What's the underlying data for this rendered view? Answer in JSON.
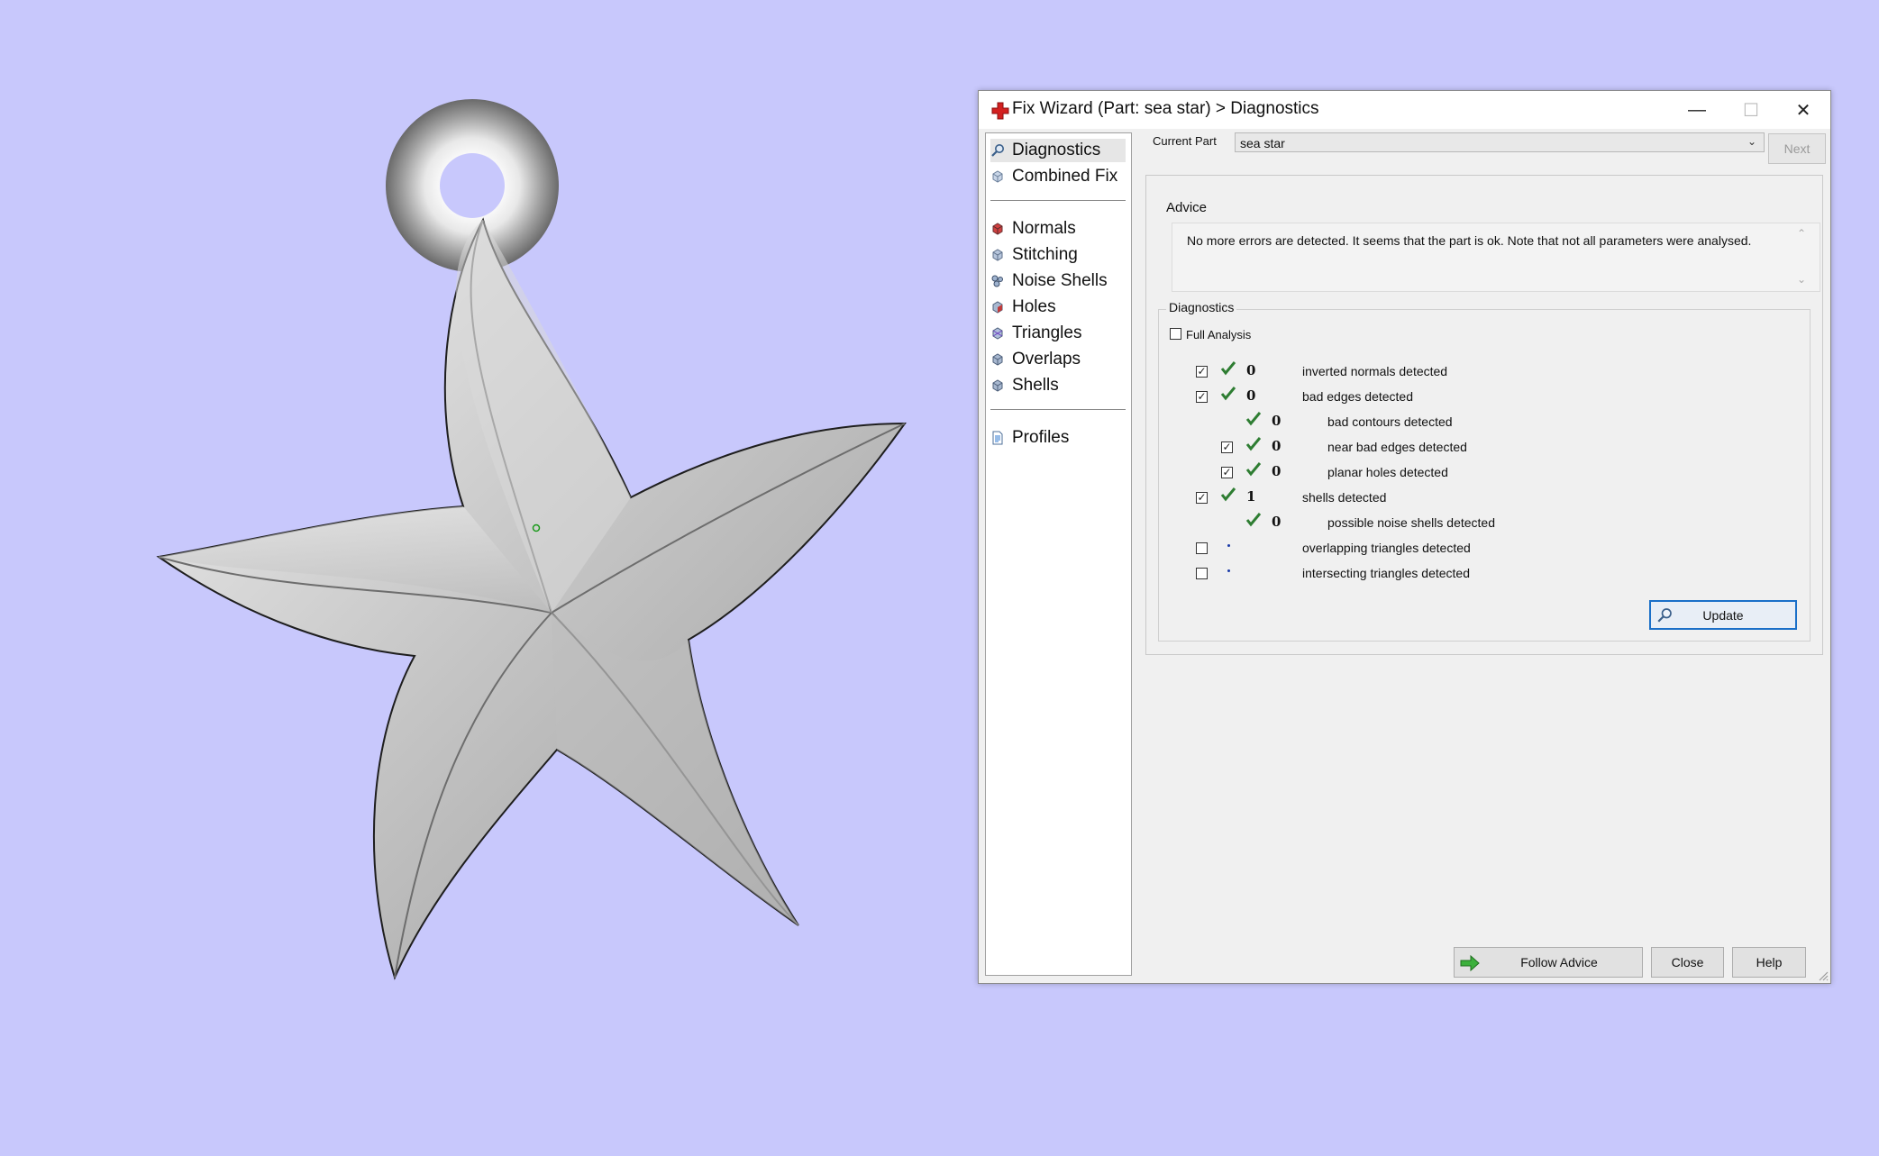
{
  "window": {
    "title": "Fix Wizard (Part: sea star) > Diagnostics",
    "controls": {
      "minimize": "—",
      "maximize": "☐",
      "close": "✕"
    }
  },
  "nav": {
    "items": [
      {
        "label": "Diagnostics",
        "icon": "magnifier-icon",
        "selected": true
      },
      {
        "label": "Combined Fix",
        "icon": "cube-icon"
      },
      {
        "label": "Normals",
        "icon": "normals-cube-icon"
      },
      {
        "label": "Stitching",
        "icon": "stitching-cube-icon"
      },
      {
        "label": "Noise Shells",
        "icon": "noise-shells-icon"
      },
      {
        "label": "Holes",
        "icon": "holes-cube-icon"
      },
      {
        "label": "Triangles",
        "icon": "triangles-cube-icon"
      },
      {
        "label": "Overlaps",
        "icon": "overlaps-cube-icon"
      },
      {
        "label": "Shells",
        "icon": "shells-cube-icon"
      },
      {
        "label": "Profiles",
        "icon": "profiles-doc-icon"
      }
    ]
  },
  "current_part": {
    "label": "Current Part",
    "value": "sea star"
  },
  "next_button": "Next",
  "advice": {
    "title": "Advice",
    "text": "No more errors are detected. It seems that the part is ok. Note that not all parameters were analysed."
  },
  "diagnostics": {
    "title": "Diagnostics",
    "full_analysis": {
      "label": "Full Analysis",
      "checked": false
    },
    "rows": [
      {
        "checked": true,
        "status": "ok",
        "count": "0",
        "label": "inverted normals detected"
      },
      {
        "checked": true,
        "status": "ok",
        "count": "0",
        "label": "bad edges detected"
      },
      {
        "checked": null,
        "status": "ok",
        "count": "0",
        "label": "bad contours detected"
      },
      {
        "checked": true,
        "status": "ok",
        "count": "0",
        "label": "near bad edges detected"
      },
      {
        "checked": true,
        "status": "ok",
        "count": "0",
        "label": "planar holes detected"
      },
      {
        "checked": true,
        "status": "ok",
        "count": "1",
        "label": "shells detected"
      },
      {
        "checked": null,
        "status": "ok",
        "count": "0",
        "label": "possible noise shells detected"
      },
      {
        "checked": false,
        "status": "not-analysed",
        "count": "",
        "label": "overlapping triangles detected"
      },
      {
        "checked": false,
        "status": "not-analysed",
        "count": "",
        "label": "intersecting triangles detected"
      }
    ],
    "update_button": "Update"
  },
  "footer": {
    "follow_advice": "Follow Advice",
    "close": "Close",
    "help": "Help"
  },
  "colors": {
    "background": "#c8c8fc",
    "check_green": "#2e7d32",
    "title_icon_red": "#d32020",
    "focus_blue": "#1a6fc8"
  }
}
